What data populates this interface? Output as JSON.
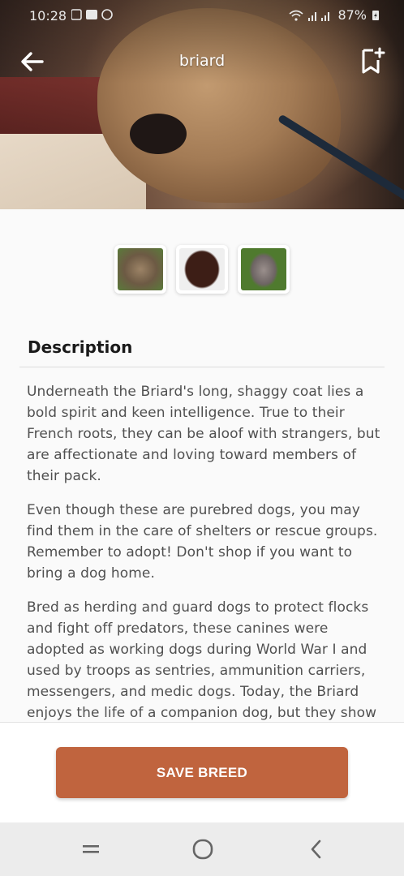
{
  "status_bar": {
    "time": "10:28",
    "battery_percent": "87%"
  },
  "header": {
    "title": "briard"
  },
  "thumbnails": [
    {
      "label": "briard-thumbnail-1"
    },
    {
      "label": "briard-thumbnail-2"
    },
    {
      "label": "briard-thumbnail-3"
    }
  ],
  "description": {
    "heading": "Description",
    "paragraphs": [
      "Underneath the Briard's long, shaggy coat lies a bold spirit and keen intelligence. True to their French roots, they can be aloof with strangers, but are affectionate and loving toward members of their pack.",
      "Even though these are purebred dogs, you may find them in the care of shelters or rescue groups. Remember to adopt! Don't shop if you want to bring a dog home.",
      "Bred as herding and guard dogs to protect flocks and fight off predators, these canines were adopted as working dogs during World War I and used by troops as sentries, ammunition carriers, messengers, and medic dogs. Today, the Briard enjoys the life of a companion dog, but they show"
    ]
  },
  "actions": {
    "save_label": "SAVE BREED"
  },
  "colors": {
    "accent": "#c0643e"
  },
  "icons": {
    "back": "arrow-left-icon",
    "bookmark": "bookmark-add-icon",
    "sys_recents": "recents-icon",
    "sys_home": "home-icon",
    "sys_back": "chevron-left-icon"
  }
}
